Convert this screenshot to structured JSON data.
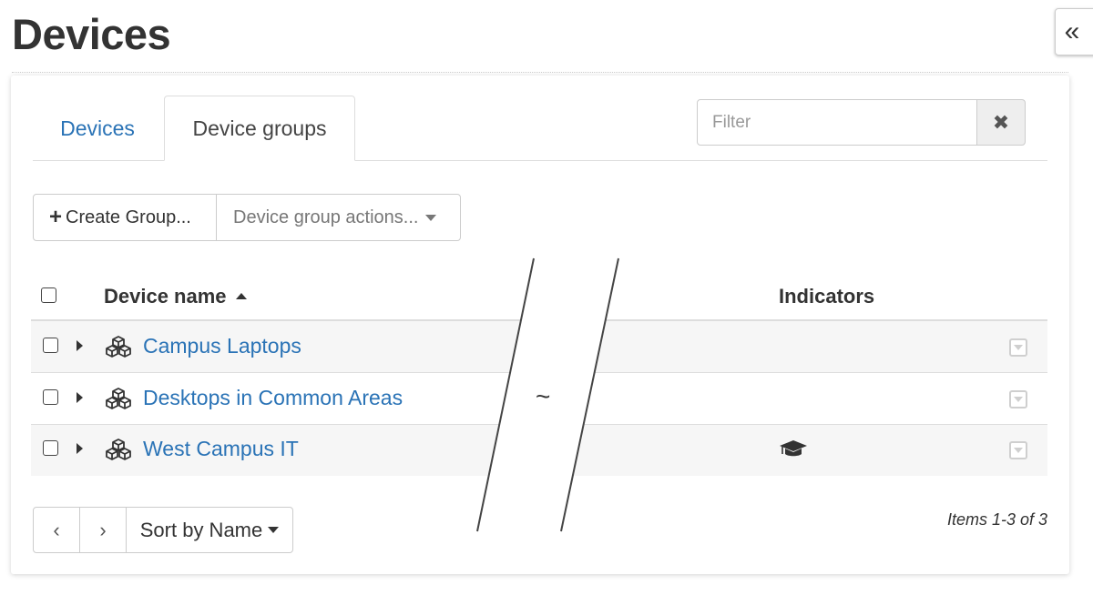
{
  "page": {
    "title": "Devices",
    "collapse_glyph": "«"
  },
  "tabs": [
    {
      "label": "Devices",
      "active": false
    },
    {
      "label": "Device groups",
      "active": true
    }
  ],
  "filter": {
    "placeholder": "Filter",
    "value": "",
    "clear_glyph": "✖"
  },
  "toolbar": {
    "create_plus": "+",
    "create_label": "Create Group...",
    "actions_label": "Device group actions..."
  },
  "table": {
    "columns": {
      "name": "Device name",
      "indicators": "Indicators"
    },
    "gap_marker": "~",
    "rows": [
      {
        "name": "Campus Laptops",
        "indicator_icon": ""
      },
      {
        "name": "Desktops in Common Areas",
        "indicator_icon": ""
      },
      {
        "name": "West Campus IT",
        "indicator_icon": "graduation-cap-icon"
      }
    ]
  },
  "pager": {
    "prev_glyph": "‹",
    "next_glyph": "›",
    "sort_label": "Sort by Name",
    "items_text": "Items 1-3 of 3"
  },
  "colors": {
    "link": "#2a73b6",
    "text": "#333333",
    "border": "#cccccc",
    "stripe": "#f6f6f6"
  }
}
